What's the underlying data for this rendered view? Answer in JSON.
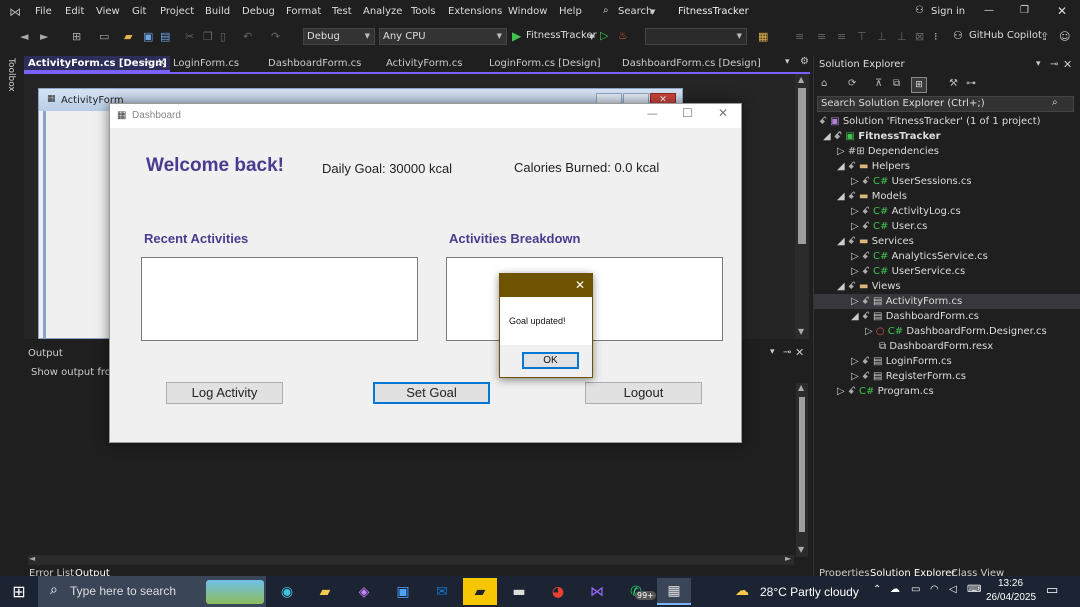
{
  "menubar": {
    "items": [
      "File",
      "Edit",
      "View",
      "Git",
      "Project",
      "Build",
      "Debug",
      "Format",
      "Test",
      "Analyze",
      "Tools",
      "Extensions",
      "Window",
      "Help"
    ],
    "search": "Search",
    "project": "FitnessTracker",
    "signin": "Sign in"
  },
  "toolbar": {
    "config": "Debug",
    "platform": "Any CPU",
    "run": "FitnessTracker",
    "copilot": "GitHub Copilot"
  },
  "tabs": [
    "ActivityForm.cs [Design]",
    "LoginForm.cs",
    "DashboardForm.cs",
    "ActivityForm.cs",
    "LoginForm.cs [Design]",
    "DashboardForm.cs [Design]"
  ],
  "side": {
    "toolbox": "Toolbox"
  },
  "designer": {
    "behind_title": "ActivityForm"
  },
  "output": {
    "title": "Output",
    "show": "Show output from:",
    "tabs": [
      "Error List",
      "Output"
    ]
  },
  "dashboard": {
    "title": "Dashboard",
    "welcome": "Welcome back!",
    "goal": "Daily Goal: 30000 kcal",
    "burned": "Calories Burned: 0.0 kcal",
    "recent": "Recent Activities",
    "breakdown": "Activities Breakdown",
    "log": "Log Activity",
    "set": "Set Goal",
    "logout": "Logout"
  },
  "msg": {
    "text": "Goal updated!",
    "ok": "OK"
  },
  "solution": {
    "title": "Solution Explorer",
    "search": "Search Solution Explorer (Ctrl+;)",
    "items": [
      "Solution 'FitnessTracker' (1 of 1 project)",
      "FitnessTracker",
      "Dependencies",
      "Helpers",
      "UserSessions.cs",
      "Models",
      "ActivityLog.cs",
      "User.cs",
      "Services",
      "AnalyticsService.cs",
      "UserService.cs",
      "Views",
      "ActivityForm.cs",
      "DashboardForm.cs",
      "DashboardForm.Designer.cs",
      "DashboardForm.resx",
      "LoginForm.cs",
      "RegisterForm.cs",
      "Program.cs"
    ],
    "bottom_tabs": [
      "Properties",
      "Solution Explorer",
      "Class View"
    ]
  },
  "taskbar": {
    "search": "Type here to search",
    "weather": "28°C  Partly cloudy",
    "time": "13:26",
    "date": "26/04/2025",
    "badge": "99+"
  }
}
